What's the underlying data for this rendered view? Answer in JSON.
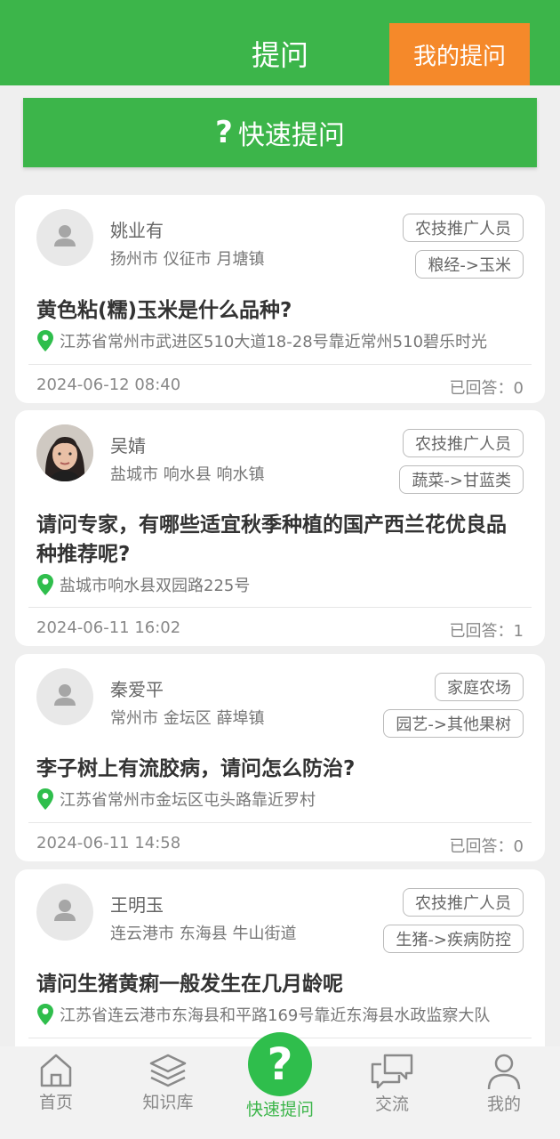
{
  "header": {
    "title": "提问",
    "my_questions_label": "我的提问"
  },
  "quick_ask": {
    "icon": "?",
    "label": "快速提问"
  },
  "accent_color": "#3cb54a",
  "questions": [
    {
      "name": "姚业有",
      "region": "扬州市 仪征市 月塘镇",
      "role_tag": "农技推广人员",
      "category_tag": "粮经->玉米",
      "title": "黄色粘(糯)玉米是什么品种?",
      "location": "江苏省常州市武进区510大道18-28号靠近常州510碧乐时光",
      "date": "2024-06-12 08:40",
      "answers": "已回答：0"
    },
    {
      "name": "吴婧",
      "region": "盐城市 响水县 响水镇",
      "role_tag": "农技推广人员",
      "category_tag": "蔬菜->甘蓝类",
      "title": "请问专家，有哪些适宜秋季种植的国产西兰花优良品种推荐呢?",
      "location": "盐城市响水县双园路225号",
      "date": "2024-06-11 16:02",
      "answers": "已回答：1"
    },
    {
      "name": "秦爱平",
      "region": "常州市 金坛区 薛埠镇",
      "role_tag": "家庭农场",
      "category_tag": "园艺->其他果树",
      "title": "李子树上有流胶病，请问怎么防治?",
      "location": "江苏省常州市金坛区屯头路靠近罗村",
      "date": "2024-06-11 14:58",
      "answers": "已回答：0"
    },
    {
      "name": "王明玉",
      "region": "连云港市 东海县 牛山街道",
      "role_tag": "农技推广人员",
      "category_tag": "生猪->疾病防控",
      "title": "请问生猪黄痢一般发生在几月龄呢",
      "location": "江苏省连云港市东海县和平路169号靠近东海县水政监察大队",
      "date": "",
      "answers": ""
    }
  ],
  "tabbar": {
    "items": [
      {
        "label": "首页",
        "icon": "home-icon"
      },
      {
        "label": "知识库",
        "icon": "layers-icon"
      },
      {
        "label": "快速提问",
        "icon": "question-icon"
      },
      {
        "label": "交流",
        "icon": "chat-icon"
      },
      {
        "label": "我的",
        "icon": "user-icon"
      }
    ]
  }
}
